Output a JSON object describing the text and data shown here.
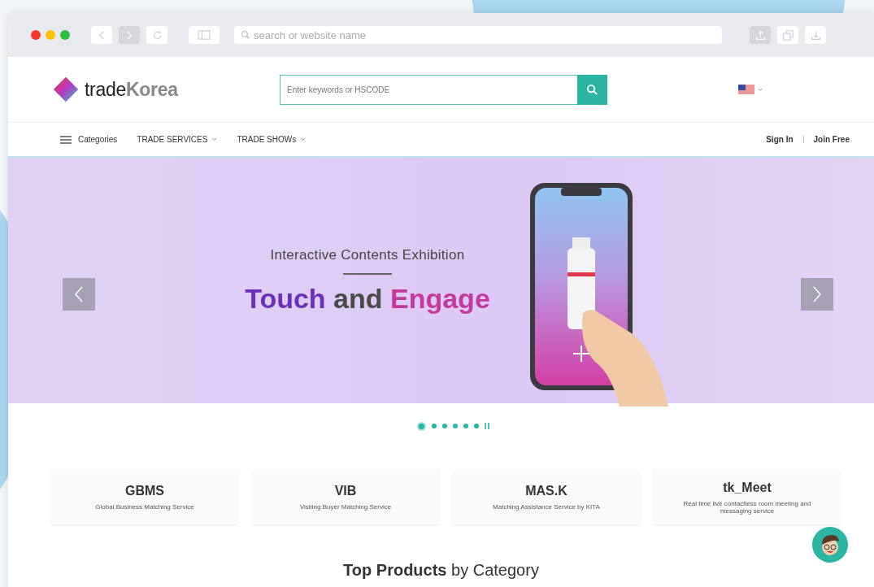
{
  "browser": {
    "address_placeholder": "search or website name"
  },
  "header": {
    "logo": {
      "plain": "trade",
      "accent": "Korea"
    },
    "search": {
      "placeholder": "Enter keywords or HSCODE"
    }
  },
  "nav": {
    "categories": "Categories",
    "menus": [
      {
        "label": "TRADE SERVICES"
      },
      {
        "label": "TRADE SHOWs"
      }
    ],
    "auth_links": [
      "Sign In",
      "Join Free"
    ]
  },
  "banner": {
    "subtitle": "Interactive Contents Exhibition",
    "headline": [
      {
        "text": "Touch",
        "color": "#6c2fb8"
      },
      {
        "text": "and",
        "color": "#4a4a4a"
      },
      {
        "text": "Engage",
        "color": "#c33a9e"
      }
    ]
  },
  "carousel_dots": [
    {
      "selected": true
    },
    {
      "selected": false
    },
    {
      "selected": false
    },
    {
      "selected": false
    },
    {
      "selected": false
    },
    {
      "selected": false
    }
  ],
  "services": [
    {
      "title": "GBMS",
      "description": "Global Business Matching Service"
    },
    {
      "title": "VIB",
      "description": "Visiting Buyer Matching Service"
    },
    {
      "title": "MAS.K",
      "description": "Matching Assistance Service by KITA"
    },
    {
      "title": "tk_Meet",
      "description": "Real time live contactless room meeting and messaging service"
    }
  ],
  "section_heading": "**Top Products** by Category"
}
